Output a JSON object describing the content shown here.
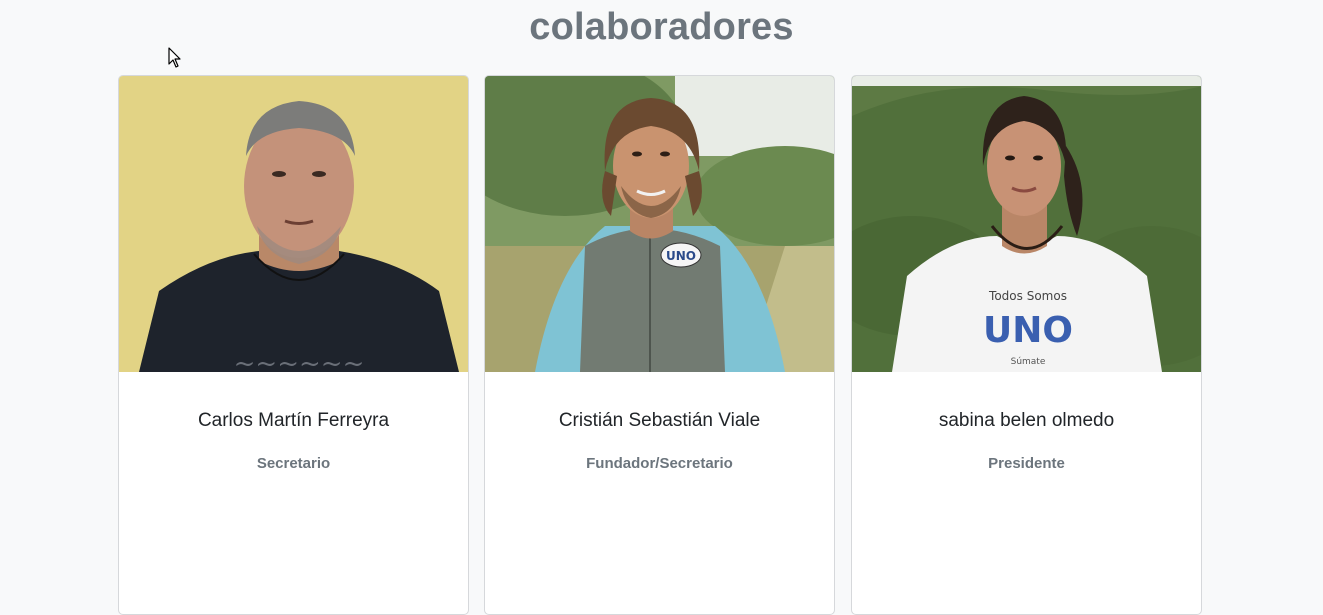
{
  "page": {
    "title": "colaboradores"
  },
  "collaborators": [
    {
      "name": "Carlos Martín Ferreyra",
      "role": "Secretario",
      "photo_icon": "person-photo"
    },
    {
      "name": "Cristián Sebastián Viale",
      "role": "Fundador/Secretario",
      "photo_icon": "person-photo"
    },
    {
      "name": "sabina belen olmedo",
      "role": "Presidente",
      "photo_icon": "person-photo"
    }
  ],
  "colors": {
    "background": "#f8f9fa",
    "title": "#6c757d",
    "name": "#212529",
    "role": "#6c757d",
    "card_border": "#d6d8db"
  }
}
